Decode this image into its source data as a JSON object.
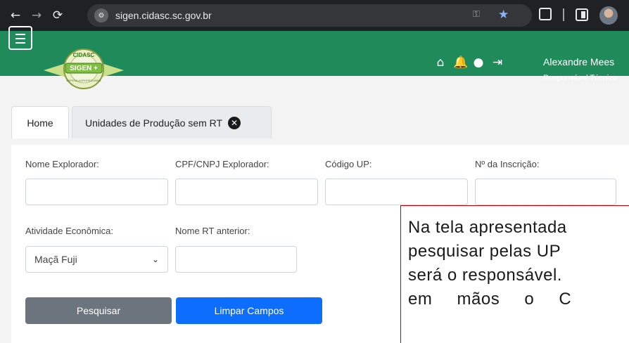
{
  "browser": {
    "url": "sigen.cidasc.sc.gov.br"
  },
  "header": {
    "logo_text_top": "CIDASC",
    "logo_text_main": "SIGEN +",
    "logo_text_bottom": "DEFESA AGROPECUARIA",
    "user_name": "Alexandre Mees",
    "user_role": "Responsável Técnico"
  },
  "tabs": [
    {
      "label": "Home"
    },
    {
      "label": "Unidades de Produção sem RT"
    }
  ],
  "form": {
    "nome_explorador_label": "Nome Explorador:",
    "cpf_label": "CPF/CNPJ Explorador:",
    "codigo_up_label": "Código UP:",
    "inscricao_label": "Nº da Inscrição:",
    "atividade_label": "Atividade Econômica:",
    "atividade_value": "Maçã Fuji",
    "rt_anterior_label": "Nome RT anterior:",
    "search_label": "Pesquisar",
    "clear_label": "Limpar Campos"
  },
  "note": {
    "lines": [
      "Na tela apresentada",
      "pesquisar pelas UP",
      "será o responsável.",
      "em mãos o C"
    ]
  },
  "colors": {
    "header_green": "#1f8b5a",
    "primary_blue": "#0d6efd",
    "secondary_gray": "#6c757d",
    "note_border": "#c00000"
  }
}
